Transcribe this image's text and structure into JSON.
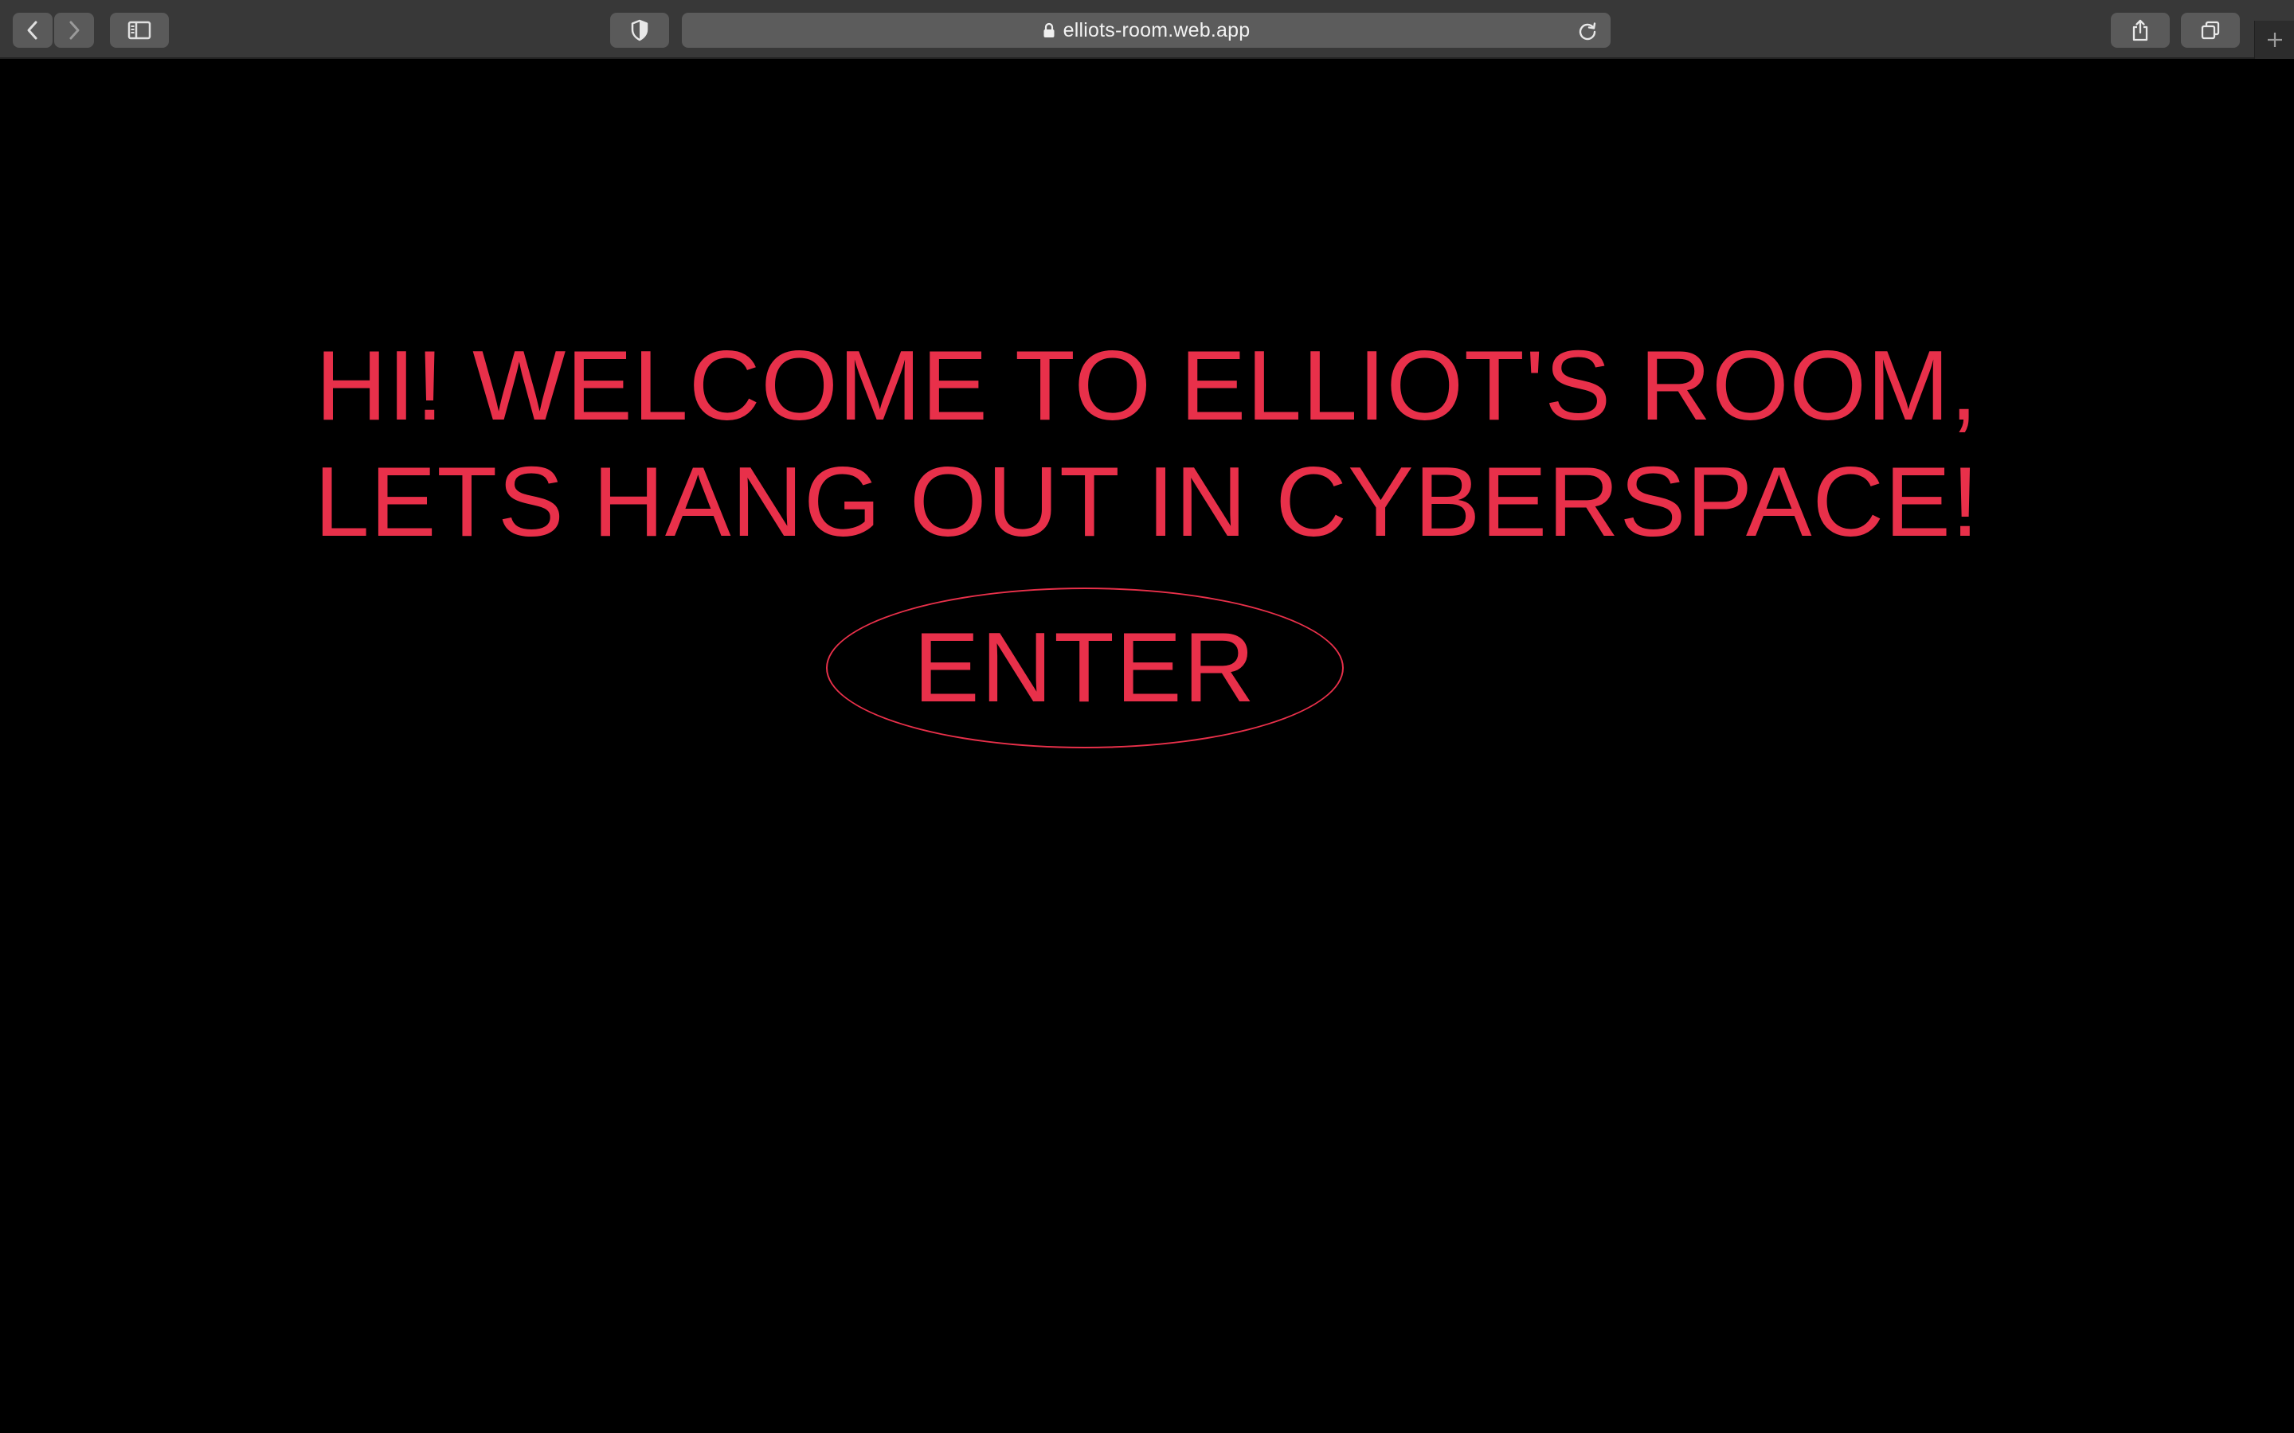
{
  "browser": {
    "address": "elliots-room.web.app",
    "icons": {
      "back": "chevron-left-icon",
      "forward": "chevron-right-icon",
      "sidebar": "sidebar-icon",
      "privacy": "shield-icon",
      "lock": "lock-icon",
      "reload": "reload-icon",
      "share": "share-icon",
      "tabs": "tabs-overview-icon",
      "new_tab": "plus-icon"
    }
  },
  "page": {
    "headline_line1": "HI! WELCOME TO ELLIOT'S ROOM,",
    "headline_line2": "LETS HANG OUT IN CYBERSPACE!",
    "enter_label": "ENTER"
  },
  "colors": {
    "accent": "#e8304a",
    "background": "#000000",
    "toolbar": "#383838"
  }
}
